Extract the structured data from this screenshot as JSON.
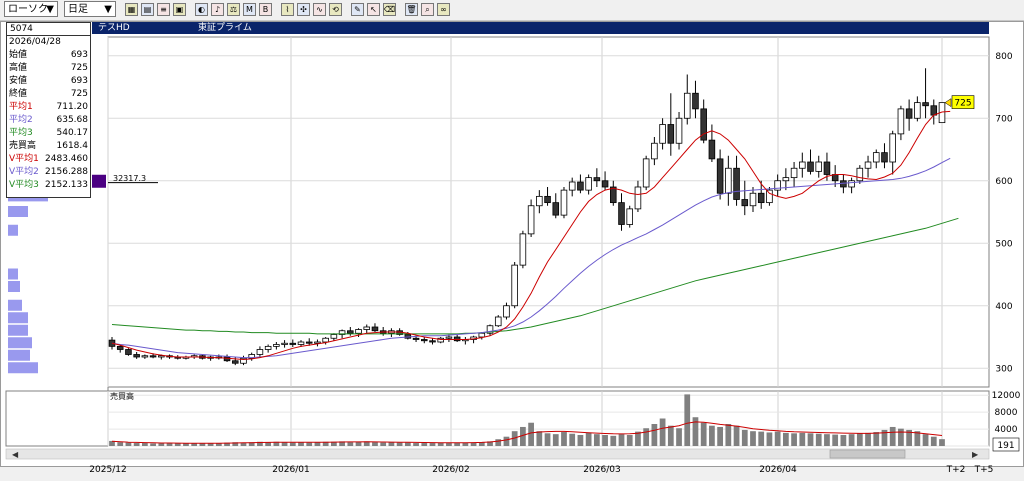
{
  "toolbar": {
    "chart_type": "ローソク",
    "period": "日足",
    "buttons": [
      "chart-icon",
      "table-icon",
      "list-icon",
      "print-icon",
      "circle-icon",
      "sound-icon",
      "balance-icon",
      "ma-icon",
      "bb-icon",
      "fibo-icon",
      "zoom-icon",
      "wave-icon",
      "reload-icon",
      "pen-icon",
      "cursor-icon",
      "eraser-icon",
      "trash-icon",
      "search-icon",
      "glasses-icon"
    ]
  },
  "header": {
    "code": "5074",
    "dot": "・",
    "name": "テスHD",
    "market": "東証プライム"
  },
  "info": {
    "date": "2026/04/28",
    "rows": [
      {
        "label": "始値",
        "value": "693",
        "color": "#000000"
      },
      {
        "label": "高値",
        "value": "725",
        "color": "#000000"
      },
      {
        "label": "安値",
        "value": "693",
        "color": "#000000"
      },
      {
        "label": "終値",
        "value": "725",
        "color": "#000000"
      },
      {
        "label": "平均1",
        "value": "711.20",
        "color": "#cc0000"
      },
      {
        "label": "平均2",
        "value": "635.68",
        "color": "#6a5acd"
      },
      {
        "label": "平均3",
        "value": "540.17",
        "color": "#228b22"
      },
      {
        "label": "売買高",
        "value": "1618.4",
        "color": "#000000"
      },
      {
        "label": "V平均1",
        "value": "2483.460",
        "color": "#cc0000"
      },
      {
        "label": "V平均2",
        "value": "2156.288",
        "color": "#6a5acd"
      },
      {
        "label": "V平均3",
        "value": "2152.133",
        "color": "#228b22"
      }
    ]
  },
  "colors": {
    "up": "#ffffff",
    "down": "#333333",
    "ma1": "#cc0000",
    "ma2": "#6a5acd",
    "ma3": "#228b22",
    "volume_bar": "#808080",
    "profile": "#9999ee",
    "price_label_bg": "#ffff00"
  },
  "price_profile_label": "32317.3",
  "last_price_label": "725",
  "volume_label": "売買高",
  "volume_current_label": "191",
  "chart_data": {
    "type": "candlestick",
    "ylim": [
      270,
      830
    ],
    "y_ticks": [
      "800",
      "700",
      "600",
      "500",
      "400",
      "300"
    ],
    "volume_ylim": [
      0,
      13000
    ],
    "volume_ticks": [
      "12000",
      "8000",
      "4000",
      "0"
    ],
    "x_labels": [
      "2025/12",
      "2026/01",
      "2026/02",
      "2026/03",
      "2026/04",
      "T+2",
      "T+5"
    ],
    "candles": [
      [
        345,
        350,
        330,
        335
      ],
      [
        335,
        338,
        325,
        330
      ],
      [
        330,
        332,
        320,
        322
      ],
      [
        322,
        326,
        315,
        318
      ],
      [
        318,
        322,
        315,
        320
      ],
      [
        320,
        324,
        316,
        318
      ],
      [
        318,
        322,
        314,
        320
      ],
      [
        320,
        322,
        315,
        318
      ],
      [
        318,
        321,
        314,
        316
      ],
      [
        316,
        320,
        314,
        318
      ],
      [
        318,
        322,
        315,
        320
      ],
      [
        320,
        322,
        314,
        316
      ],
      [
        316,
        320,
        312,
        318
      ],
      [
        318,
        322,
        314,
        318
      ],
      [
        318,
        322,
        310,
        312
      ],
      [
        312,
        318,
        305,
        308
      ],
      [
        308,
        320,
        305,
        316
      ],
      [
        316,
        325,
        312,
        322
      ],
      [
        322,
        335,
        318,
        330
      ],
      [
        330,
        338,
        325,
        335
      ],
      [
        335,
        342,
        330,
        338
      ],
      [
        338,
        345,
        333,
        340
      ],
      [
        340,
        346,
        334,
        338
      ],
      [
        338,
        345,
        334,
        342
      ],
      [
        342,
        348,
        336,
        340
      ],
      [
        340,
        346,
        335,
        342
      ],
      [
        342,
        350,
        338,
        348
      ],
      [
        348,
        356,
        344,
        354
      ],
      [
        354,
        362,
        348,
        360
      ],
      [
        360,
        366,
        352,
        356
      ],
      [
        356,
        364,
        350,
        362
      ],
      [
        362,
        370,
        356,
        366
      ],
      [
        366,
        372,
        358,
        360
      ],
      [
        360,
        366,
        352,
        356
      ],
      [
        356,
        364,
        350,
        360
      ],
      [
        360,
        364,
        352,
        354
      ],
      [
        354,
        358,
        346,
        348
      ],
      [
        348,
        352,
        342,
        346
      ],
      [
        346,
        350,
        340,
        344
      ],
      [
        344,
        348,
        338,
        342
      ],
      [
        342,
        350,
        340,
        348
      ],
      [
        348,
        354,
        342,
        350
      ],
      [
        350,
        354,
        342,
        344
      ],
      [
        344,
        350,
        338,
        346
      ],
      [
        346,
        352,
        340,
        350
      ],
      [
        350,
        358,
        346,
        356
      ],
      [
        356,
        370,
        352,
        368
      ],
      [
        368,
        385,
        366,
        382
      ],
      [
        382,
        405,
        378,
        400
      ],
      [
        400,
        470,
        396,
        465
      ],
      [
        465,
        520,
        460,
        515
      ],
      [
        515,
        570,
        510,
        560
      ],
      [
        560,
        585,
        548,
        575
      ],
      [
        575,
        590,
        560,
        565
      ],
      [
        565,
        580,
        540,
        545
      ],
      [
        545,
        590,
        540,
        585
      ],
      [
        585,
        605,
        575,
        598
      ],
      [
        598,
        610,
        580,
        585
      ],
      [
        585,
        610,
        578,
        605
      ],
      [
        605,
        620,
        590,
        600
      ],
      [
        600,
        615,
        585,
        590
      ],
      [
        590,
        600,
        560,
        565
      ],
      [
        565,
        580,
        520,
        530
      ],
      [
        530,
        560,
        525,
        555
      ],
      [
        555,
        600,
        550,
        590
      ],
      [
        590,
        640,
        585,
        635
      ],
      [
        635,
        670,
        625,
        660
      ],
      [
        660,
        700,
        650,
        690
      ],
      [
        690,
        740,
        640,
        660
      ],
      [
        660,
        710,
        650,
        700
      ],
      [
        700,
        770,
        690,
        740
      ],
      [
        740,
        760,
        700,
        715
      ],
      [
        715,
        730,
        660,
        665
      ],
      [
        665,
        690,
        630,
        635
      ],
      [
        635,
        650,
        570,
        580
      ],
      [
        580,
        640,
        560,
        620
      ],
      [
        620,
        640,
        560,
        570
      ],
      [
        570,
        600,
        545,
        560
      ],
      [
        560,
        590,
        550,
        580
      ],
      [
        580,
        600,
        555,
        565
      ],
      [
        565,
        590,
        560,
        585
      ],
      [
        585,
        610,
        575,
        600
      ],
      [
        600,
        620,
        585,
        605
      ],
      [
        605,
        630,
        590,
        620
      ],
      [
        620,
        645,
        605,
        630
      ],
      [
        630,
        650,
        610,
        615
      ],
      [
        615,
        640,
        605,
        630
      ],
      [
        630,
        645,
        600,
        610
      ],
      [
        610,
        625,
        590,
        600
      ],
      [
        600,
        610,
        580,
        590
      ],
      [
        590,
        605,
        580,
        600
      ],
      [
        600,
        625,
        595,
        620
      ],
      [
        620,
        640,
        605,
        630
      ],
      [
        630,
        650,
        620,
        645
      ],
      [
        645,
        660,
        620,
        630
      ],
      [
        630,
        680,
        610,
        675
      ],
      [
        675,
        720,
        665,
        715
      ],
      [
        715,
        730,
        680,
        700
      ],
      [
        700,
        735,
        695,
        725
      ],
      [
        725,
        780,
        700,
        720
      ],
      [
        720,
        730,
        690,
        705
      ],
      [
        693,
        725,
        693,
        725
      ]
    ],
    "ma1": [
      340,
      337,
      333,
      329,
      326,
      323,
      321,
      319,
      318,
      318,
      318,
      318,
      317,
      317,
      316,
      315,
      314,
      315,
      317,
      320,
      324,
      328,
      332,
      335,
      337,
      339,
      341,
      344,
      347,
      350,
      353,
      356,
      357,
      358,
      358,
      358,
      356,
      353,
      350,
      348,
      346,
      346,
      346,
      346,
      347,
      349,
      352,
      358,
      366,
      379,
      398,
      420,
      446,
      470,
      490,
      510,
      530,
      550,
      567,
      578,
      585,
      588,
      585,
      580,
      578,
      580,
      590,
      605,
      620,
      635,
      650,
      665,
      675,
      680,
      675,
      665,
      650,
      635,
      615,
      595,
      580,
      575,
      572,
      575,
      580,
      590,
      600,
      607,
      610,
      610,
      608,
      605,
      603,
      602,
      606,
      612,
      625,
      645,
      668,
      690,
      705,
      710,
      711
    ],
    "ma2": [
      340,
      338,
      337,
      335,
      333,
      331,
      329,
      327,
      325,
      324,
      323,
      322,
      321,
      320,
      319,
      318,
      317,
      317,
      318,
      319,
      320,
      322,
      324,
      326,
      328,
      330,
      332,
      334,
      336,
      338,
      340,
      342,
      344,
      346,
      348,
      349,
      350,
      351,
      352,
      352,
      352,
      353,
      354,
      355,
      356,
      357,
      359,
      361,
      364,
      368,
      374,
      382,
      392,
      403,
      415,
      428,
      440,
      452,
      463,
      473,
      482,
      490,
      497,
      503,
      509,
      515,
      522,
      529,
      537,
      545,
      553,
      561,
      568,
      574,
      578,
      581,
      583,
      584,
      585,
      586,
      587,
      588,
      589,
      590,
      591,
      592,
      593,
      594,
      595,
      596,
      597,
      598,
      599,
      600,
      601,
      602,
      604,
      607,
      611,
      616,
      622,
      629,
      636
    ],
    "ma3": [
      370,
      369,
      368,
      367,
      366,
      365,
      364,
      363,
      362,
      361,
      361,
      360,
      360,
      359,
      359,
      358,
      358,
      357,
      357,
      357,
      356,
      356,
      356,
      356,
      356,
      355,
      355,
      355,
      355,
      355,
      355,
      355,
      355,
      355,
      355,
      355,
      355,
      355,
      355,
      355,
      355,
      355,
      355,
      356,
      356,
      357,
      358,
      359,
      360,
      362,
      364,
      366,
      369,
      372,
      375,
      378,
      381,
      384,
      388,
      392,
      396,
      400,
      404,
      408,
      412,
      416,
      420,
      424,
      428,
      432,
      436,
      440,
      443,
      446,
      449,
      452,
      455,
      458,
      461,
      464,
      467,
      470,
      473,
      476,
      479,
      482,
      485,
      488,
      491,
      494,
      497,
      500,
      503,
      506,
      509,
      512,
      515,
      518,
      521,
      524,
      528,
      532,
      536,
      540
    ],
    "volume": [
      1200,
      900,
      800,
      700,
      700,
      600,
      600,
      700,
      600,
      600,
      700,
      600,
      700,
      600,
      800,
      900,
      800,
      900,
      1000,
      900,
      1000,
      900,
      800,
      900,
      800,
      900,
      1000,
      1000,
      1100,
      900,
      1000,
      1100,
      900,
      800,
      900,
      800,
      800,
      700,
      700,
      700,
      800,
      700,
      700,
      800,
      800,
      900,
      1100,
      1600,
      2200,
      3500,
      4500,
      5500,
      3500,
      3000,
      2800,
      3300,
      2900,
      2600,
      3200,
      2800,
      2600,
      2400,
      2800,
      2600,
      3400,
      4200,
      5200,
      6500,
      4800,
      4200,
      12200,
      6800,
      5500,
      4800,
      4500,
      5200,
      4800,
      3800,
      3500,
      3400,
      3200,
      3400,
      3100,
      3000,
      3100,
      3000,
      2900,
      2800,
      2700,
      2600,
      2800,
      3000,
      3100,
      3300,
      3800,
      4500,
      4100,
      3800,
      3500,
      2800,
      2200,
      1618
    ],
    "vma": [
      1100,
      1000,
      900,
      850,
      800,
      750,
      700,
      700,
      680,
      660,
      660,
      650,
      650,
      650,
      680,
      720,
      750,
      780,
      820,
      850,
      870,
      880,
      880,
      880,
      880,
      890,
      900,
      920,
      950,
      960,
      980,
      1000,
      980,
      950,
      930,
      900,
      880,
      850,
      820,
      800,
      790,
      780,
      780,
      790,
      810,
      850,
      950,
      1150,
      1450,
      1900,
      2500,
      3100,
      3300,
      3400,
      3450,
      3450,
      3350,
      3250,
      3150,
      3050,
      2950,
      2880,
      2850,
      2880,
      3000,
      3300,
      3700,
      4200,
      4500,
      4800,
      5400,
      5700,
      5600,
      5400,
      5100,
      4900,
      4700,
      4400,
      4100,
      3900,
      3700,
      3600,
      3450,
      3350,
      3300,
      3250,
      3200,
      3150,
      3100,
      3050,
      3000,
      2980,
      2990,
      3050,
      3150,
      3250,
      3300,
      3250,
      3100,
      2900,
      2700,
      2483
    ],
    "price_profile": [
      [
        300,
        30
      ],
      [
        320,
        22
      ],
      [
        340,
        24
      ],
      [
        360,
        20
      ],
      [
        380,
        20
      ],
      [
        400,
        14
      ],
      [
        430,
        12
      ],
      [
        450,
        10
      ],
      [
        520,
        10
      ],
      [
        550,
        20
      ],
      [
        575,
        40
      ],
      [
        600,
        70
      ]
    ]
  }
}
